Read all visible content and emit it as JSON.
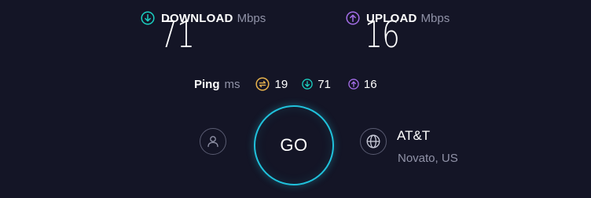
{
  "download": {
    "icon": "download-arrow-icon",
    "title": "DOWNLOAD",
    "unit": "Mbps",
    "value": "71",
    "color": "#1ad0c2"
  },
  "upload": {
    "icon": "upload-arrow-icon",
    "title": "UPLOAD",
    "unit": "Mbps",
    "value": "16",
    "color": "#a46ee8"
  },
  "ping": {
    "label": "Ping",
    "unit": "ms",
    "idle": {
      "icon": "idle-latency-icon",
      "value": "19",
      "color": "#e8b34d"
    },
    "download": {
      "icon": "download-latency-icon",
      "value": "71",
      "color": "#1ad0c2"
    },
    "upload": {
      "icon": "upload-latency-icon",
      "value": "16",
      "color": "#a46ee8"
    }
  },
  "go_button": {
    "label": "GO",
    "ring_color": "#20c2dc"
  },
  "user": {
    "icon": "user-icon"
  },
  "isp": {
    "icon": "globe-icon",
    "name": "AT&T",
    "location": "Novato, US"
  }
}
